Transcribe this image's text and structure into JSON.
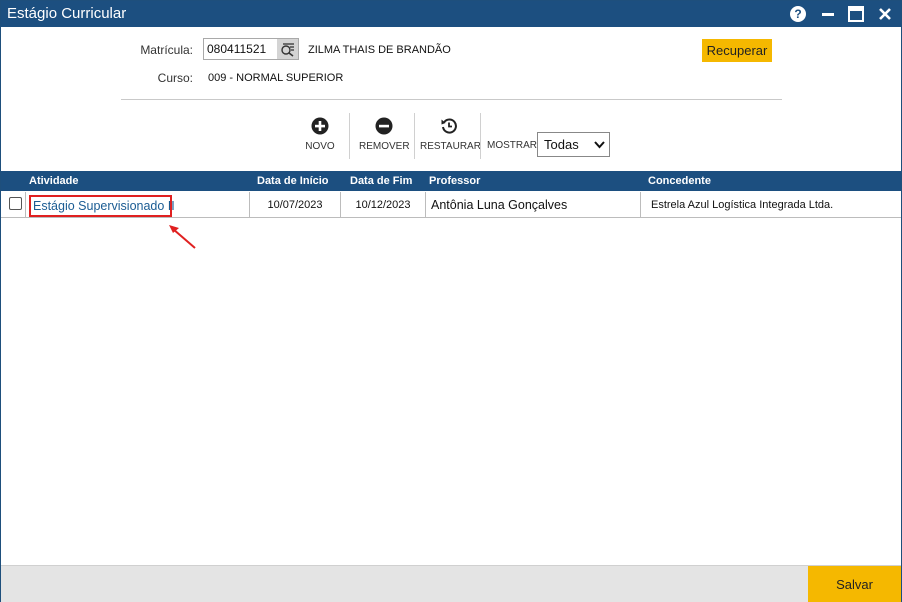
{
  "window": {
    "title": "Estágio Curricular",
    "help_symbol": "?"
  },
  "form": {
    "matricula_label": "Matrícula:",
    "matricula_value": "080411521",
    "student_name": "ZILMA THAIS DE BRANDÃO",
    "curso_label": "Curso:",
    "curso_value": "009 - NORMAL SUPERIOR",
    "recuperar_label": "Recuperar"
  },
  "toolbar": {
    "novo_label": "NOVO",
    "remover_label": "REMOVER",
    "restaurar_label": "RESTAURAR",
    "mostrar_label": "MOSTRAR:",
    "mostrar_value": "Todas"
  },
  "grid": {
    "columns": [
      "Atividade",
      "Data de Início",
      "Data de Fim",
      "Professor",
      "Concedente"
    ],
    "rows": [
      {
        "atividade": "Estágio Supervisionado II",
        "data_inicio": "10/07/2023",
        "data_fim": "10/12/2023",
        "professor": "Antônia Luna Gonçalves",
        "concedente": "Estrela Azul Logística Integrada Ltda."
      }
    ]
  },
  "footer": {
    "salvar_label": "Salvar"
  },
  "colors": {
    "titlebar": "#1c4f80",
    "accent_button": "#f5b800",
    "highlight_border": "#e02020",
    "link": "#1b5c93"
  },
  "icons": [
    "help-icon",
    "minimize-icon",
    "maximize-icon",
    "close-icon",
    "lookup-icon",
    "plus-circle-icon",
    "minus-circle-icon",
    "restore-icon",
    "chevron-down-icon",
    "annotation-arrow-icon"
  ]
}
